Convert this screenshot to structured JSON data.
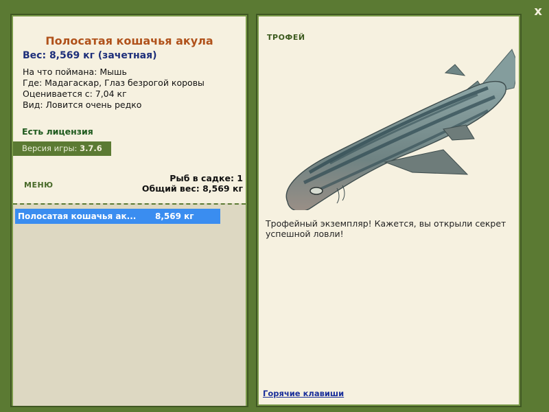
{
  "window": {
    "close_label": "x"
  },
  "fish": {
    "title": "Полосатая кошачья акула",
    "weight_line": "Вес: 8,569 кг (зачетная)",
    "caught_with": "На что поймана: Мышь",
    "location": "Где: Мадагаскар, Глаз безрогой коровы",
    "rated_from": "Оценивается с: 7,04 кг",
    "rarity": "Вид: Ловится очень редко"
  },
  "license": {
    "label": "Есть лицензия"
  },
  "version": {
    "label": "Версия игры:",
    "value": "3.7.6"
  },
  "menu": {
    "label": "МЕНЮ"
  },
  "cage": {
    "count_line": "Рыб в садке: 1",
    "total_line": "Общий вес: 8,569 кг",
    "items": [
      {
        "name": "Полосатая кошачья ак...",
        "weight": "8,569 кг"
      }
    ]
  },
  "trophy": {
    "label": "ТРОФЕЙ",
    "text": "Трофейный экземпляр! Кажется, вы открыли секрет успешной ловли!"
  },
  "footer": {
    "hotkeys_label": "Горячие клавиши"
  },
  "colors": {
    "background": "#5b7a33",
    "panel": "#f6f1e0",
    "accent_title": "#b0521b",
    "selection": "#3a8df0"
  },
  "icons": {
    "close": "close-icon",
    "fish": "striped-catshark-image"
  }
}
